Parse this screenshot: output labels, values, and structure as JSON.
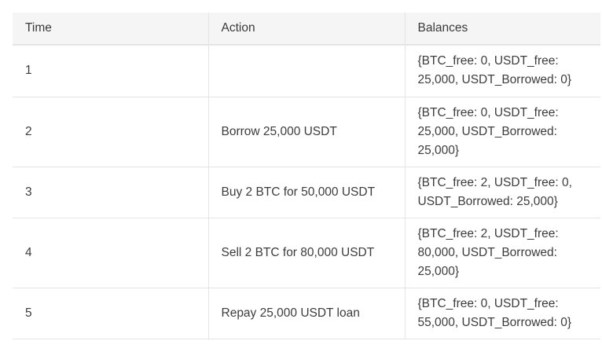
{
  "table": {
    "headers": {
      "time": "Time",
      "action": "Action",
      "balances": "Balances"
    },
    "rows": [
      {
        "time": "1",
        "action": "",
        "balances": "{BTC_free: 0, USDT_free: 25,000, USDT_Borrowed: 0}"
      },
      {
        "time": "2",
        "action": "Borrow 25,000 USDT",
        "balances": "{BTC_free: 0, USDT_free: 25,000, USDT_Borrowed: 25,000}"
      },
      {
        "time": "3",
        "action": "Buy 2 BTC for 50,000 USDT",
        "balances": "{BTC_free: 2, USDT_free: 0, USDT_Borrowed: 25,000}"
      },
      {
        "time": "4",
        "action": "Sell 2 BTC for 80,000 USDT",
        "balances": "{BTC_free: 2, USDT_free: 80,000, USDT_Borrowed: 25,000}"
      },
      {
        "time": "5",
        "action": "Repay 25,000 USDT loan",
        "balances": "{BTC_free: 0, USDT_free: 55,000, USDT_Borrowed: 0}"
      }
    ]
  }
}
